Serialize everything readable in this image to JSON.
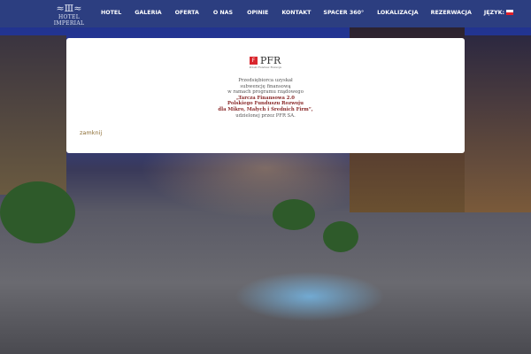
{
  "nav": {
    "logo_text": "HOTEL IMPERIAL",
    "items": [
      "HOTEL",
      "GALERIA",
      "OFERTA",
      "O NAS",
      "OPINIE",
      "KONTAKT",
      "SPACER 360°",
      "LOKALIZACJA",
      "REZERWACJA",
      "JĘZYK:"
    ],
    "language_flag": "flag-pl-icon"
  },
  "modal": {
    "logo_text": "PFR",
    "logo_subtitle": "Polski Fundusz Rozwoju",
    "lines": [
      "Przedsiębiorca uzyskał",
      "subwencję finansową",
      "w ramach programu rządowego"
    ],
    "bold_lines": [
      "„Tarcza Finansowa 2.0",
      "Polskiego Funduszu Rozwoju",
      "dla Mikro, Małych i Średnich Firm”,"
    ],
    "last_line": "udzielonej przez PFR SA.",
    "close_label": "zamknij"
  },
  "colors": {
    "nav_bg": "#2c3e80",
    "accent_red": "#d9272e"
  }
}
